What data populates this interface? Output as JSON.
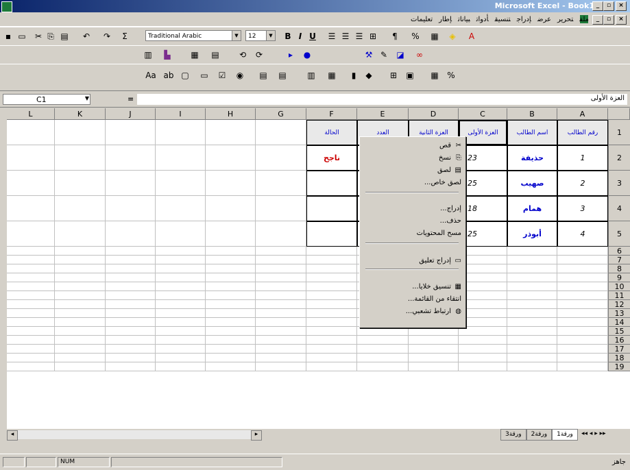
{
  "window": {
    "title": "Microsoft Excel - Book1"
  },
  "menu": [
    "ملف",
    "تحرير",
    "عرض",
    "إدراج",
    "تنسيق",
    "أدوات",
    "بيانات",
    "إطار",
    "تعليمات"
  ],
  "toolbar": {
    "font": "Traditional Arabic",
    "size": "12",
    "bold": "B",
    "italic": "I",
    "underline": "U",
    "percent": "%",
    "sigma": "Σ"
  },
  "formula": {
    "name_box": "C1",
    "eq": "=",
    "content": "العزة الأولى"
  },
  "columns": [
    "A",
    "B",
    "C",
    "D",
    "E",
    "F",
    "G",
    "H",
    "I",
    "J",
    "K",
    "L"
  ],
  "rows": [
    "1",
    "2",
    "3",
    "4",
    "5",
    "6",
    "7",
    "8",
    "9",
    "10",
    "11",
    "12",
    "13",
    "14",
    "15",
    "16",
    "17",
    "18",
    "19"
  ],
  "table": {
    "headers": [
      "رقم الطالب",
      "اسم الطالب",
      "العزة الأولى",
      "العزة الثانية",
      "العدد",
      "الحالة"
    ],
    "rows": [
      {
        "num": "1",
        "name": "حذيفة",
        "score": "23"
      },
      {
        "num": "2",
        "name": "صهيب",
        "score": "25"
      },
      {
        "num": "3",
        "name": "همام",
        "score": "18"
      },
      {
        "num": "4",
        "name": "أبوذر",
        "score": "25"
      }
    ],
    "status_f2": "ناجح"
  },
  "context_menu": {
    "items": [
      "قص",
      "نسخ",
      "لصق",
      "لصق خاص...",
      "إدراج...",
      "حذف...",
      "مسح المحتويات",
      "إدراج تعليق",
      "تنسيق خلايا...",
      "انتقاء من القائمة...",
      "ارتباط تشعبي..."
    ]
  },
  "sheet_tabs": [
    "ورقة1",
    "ورقة2",
    "ورقة3"
  ],
  "status": {
    "left": "جاهز",
    "num": "NUM"
  },
  "colors": {
    "title_start": "#0a246a",
    "blue_text": "#0000cc",
    "red_text": "#cc0000"
  }
}
